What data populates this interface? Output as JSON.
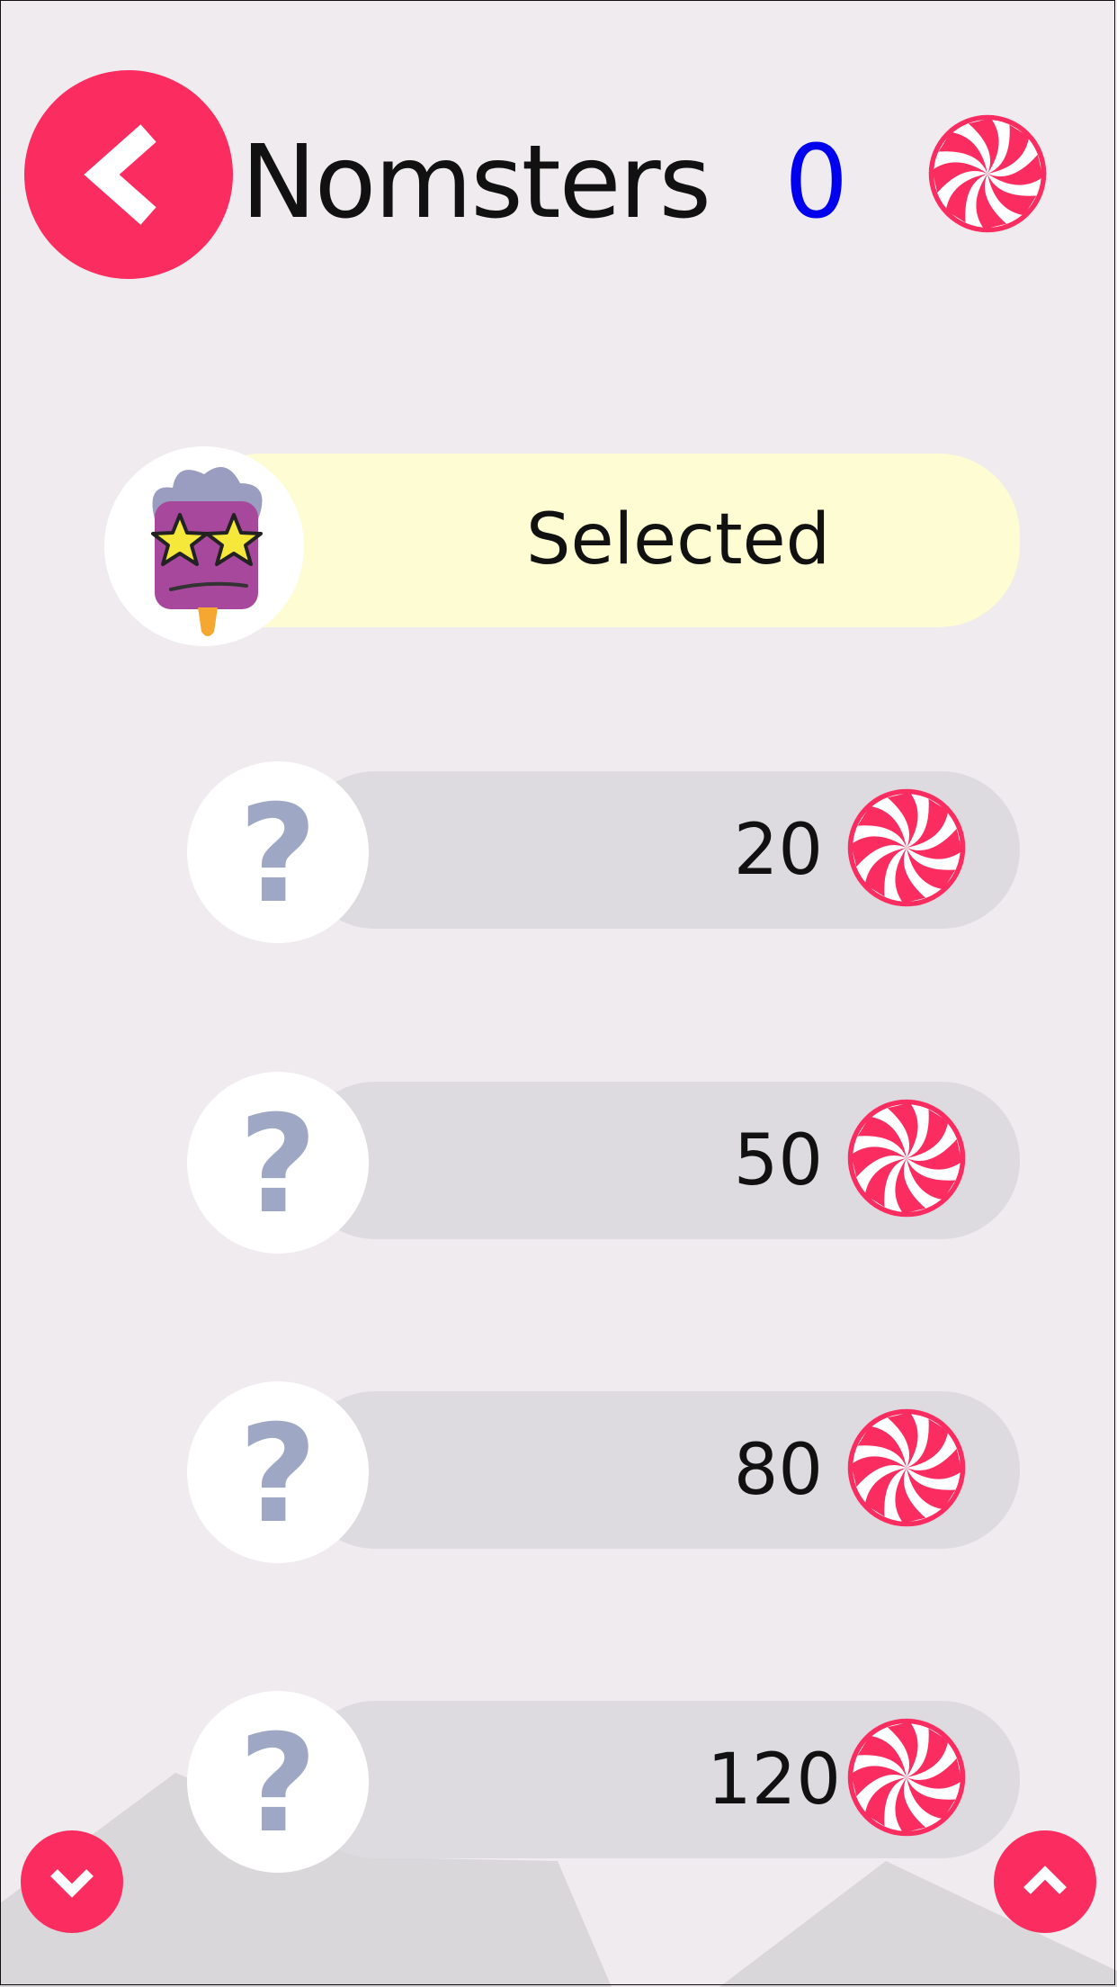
{
  "header": {
    "title": "Nomsters",
    "balance": "0",
    "back_icon": "chevron-left-icon",
    "currency_icon": "peppermint-candy-icon"
  },
  "colors": {
    "accent": "#fb2c5f",
    "balance": "#0000ee",
    "selected_pill": "#fdfcd2",
    "locked_pill": "#dddbdf",
    "question_mark": "#9ea8c4",
    "background": "#efebef"
  },
  "nomsters": [
    {
      "state": "selected",
      "label": "Selected",
      "avatar": "purple-popsicle-star-eyes-nomster"
    },
    {
      "state": "locked",
      "price": "20",
      "avatar": "question-mark-icon"
    },
    {
      "state": "locked",
      "price": "50",
      "avatar": "question-mark-icon"
    },
    {
      "state": "locked",
      "price": "80",
      "avatar": "question-mark-icon"
    },
    {
      "state": "locked",
      "price": "120",
      "avatar": "question-mark-icon"
    }
  ],
  "locked_symbol": "?",
  "footer": {
    "scroll_down_icon": "chevron-down-icon",
    "scroll_up_icon": "chevron-up-icon"
  }
}
